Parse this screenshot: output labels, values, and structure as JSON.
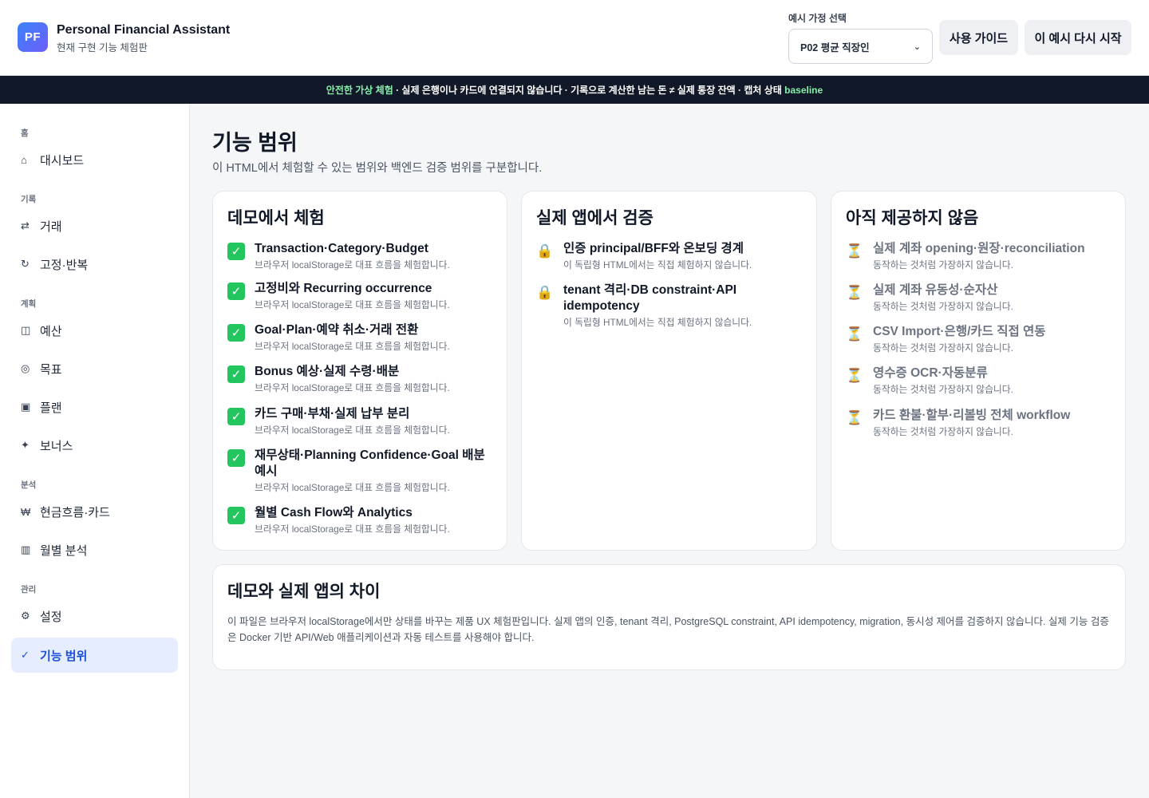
{
  "header": {
    "logo": "PF",
    "title": "Personal Financial Assistant",
    "subtitle": "현재 구현 기능 체험판",
    "persona_label": "예시 가정 선택",
    "persona_value": "P02 평균 직장인",
    "guide_button": "사용 가이드",
    "restart_button": "이 예시 다시 시작"
  },
  "banner": {
    "highlight": "안전한 가상 체험",
    "text": " · 실제 은행이나 카드에 연결되지 않습니다 · 기록으로 계산한 남는 돈 ≠ 실제 통장 잔액 · 캡처 상태 ",
    "state": "baseline"
  },
  "sidebar": {
    "sections": [
      "홈",
      "기록",
      "계획",
      "분석",
      "관리"
    ],
    "items": [
      {
        "label": "대시보드",
        "icon": "⌂"
      },
      {
        "label": "거래",
        "icon": "⇄"
      },
      {
        "label": "고정·반복",
        "icon": "↻"
      },
      {
        "label": "예산",
        "icon": "◫"
      },
      {
        "label": "목표",
        "icon": "◎"
      },
      {
        "label": "플랜",
        "icon": "▣"
      },
      {
        "label": "보너스",
        "icon": "✦"
      },
      {
        "label": "현금흐름·카드",
        "icon": "₩"
      },
      {
        "label": "월별 분석",
        "icon": "▥"
      },
      {
        "label": "설정",
        "icon": "⚙"
      },
      {
        "label": "기능 범위",
        "icon": "✓"
      }
    ]
  },
  "main": {
    "title": "기능 범위",
    "description": "이 HTML에서 체험할 수 있는 범위와 백엔드 검증 범위를 구분합니다.",
    "demo": {
      "title": "데모에서 체험",
      "desc": "브라우저 localStorage로 대표 흐름을 체험합니다.",
      "items": [
        "Transaction·Category·Budget",
        "고정비와 Recurring occurrence",
        "Goal·Plan·예약 취소·거래 전환",
        "Bonus 예상·실제 수령·배분",
        "카드 구매·부채·실제 납부 분리",
        "재무상태·Planning Confidence·Goal 배분 예시",
        "월별 Cash Flow와 Analytics"
      ]
    },
    "real": {
      "title": "실제 앱에서 검증",
      "desc": "이 독립형 HTML에서는 직접 체험하지 않습니다.",
      "items": [
        "인증 principal/BFF와 온보딩 경계",
        "tenant 격리·DB constraint·API idempotency"
      ]
    },
    "notyet": {
      "title": "아직 제공하지 않음",
      "desc": "동작하는 것처럼 가장하지 않습니다.",
      "items": [
        "실제 계좌 opening·원장·reconciliation",
        "실제 계좌 유동성·순자산",
        "CSV Import·은행/카드 직접 연동",
        "영수증 OCR·자동분류",
        "카드 환불·할부·리볼빙 전체 workflow"
      ]
    },
    "diff": {
      "title": "데모와 실제 앱의 차이",
      "text": "이 파일은 브라우저 localStorage에서만 상태를 바꾸는 제품 UX 체험판입니다. 실제 앱의 인증, tenant 격리, PostgreSQL constraint, API idempotency, migration, 동시성 제어를 검증하지 않습니다. 실제 기능 검증은 Docker 기반 API/Web 애플리케이션과 자동 테스트를 사용해야 합니다."
    }
  }
}
